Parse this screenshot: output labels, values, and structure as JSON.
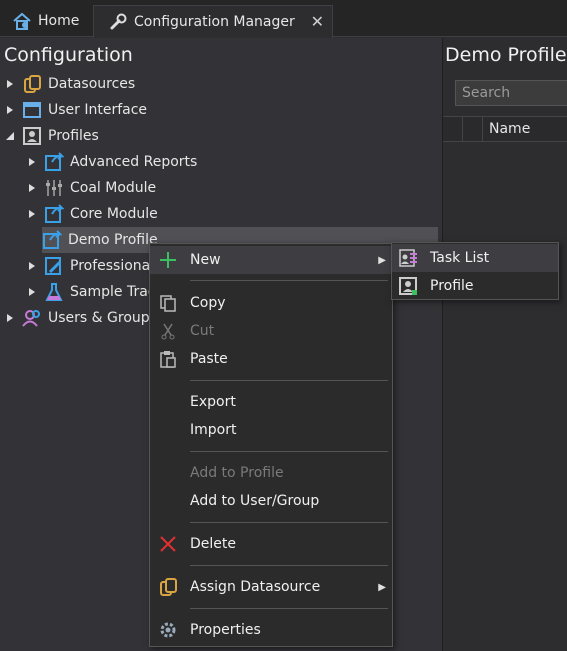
{
  "tabs": [
    {
      "label": "Home",
      "icon": "home-icon"
    },
    {
      "label": "Configuration Manager",
      "icon": "wrench-icon",
      "close": "✕"
    }
  ],
  "left_panel": {
    "title": "Configuration",
    "tree": [
      {
        "label": "Datasources",
        "icon": "datasource-icon",
        "expanded": false
      },
      {
        "label": "User Interface",
        "icon": "window-icon",
        "expanded": false
      },
      {
        "label": "Profiles",
        "icon": "profile-icon",
        "expanded": true
      },
      {
        "label": "Advanced Reports",
        "icon": "profile-share-icon",
        "expanded": false
      },
      {
        "label": "Coal Module",
        "icon": "coal-icon",
        "expanded": false
      },
      {
        "label": "Core Module",
        "icon": "profile-share-icon",
        "expanded": false
      },
      {
        "label": "Demo Profile",
        "icon": "profile-share-icon",
        "selected": true
      },
      {
        "label": "Professional",
        "icon": "profile-edit-icon",
        "expanded": false
      },
      {
        "label": "Sample Trac",
        "icon": "flask-icon",
        "expanded": false
      },
      {
        "label": "Users & Groups",
        "icon": "users-icon",
        "expanded": false
      }
    ]
  },
  "right_panel": {
    "title": "Demo Profile",
    "search_placeholder": "Search",
    "column_name": "Name"
  },
  "context_menu": {
    "new": "New",
    "copy": "Copy",
    "cut": "Cut",
    "paste": "Paste",
    "export": "Export",
    "import": "Import",
    "add_to_profile": "Add to Profile",
    "add_to_user_group": "Add to User/Group",
    "delete": "Delete",
    "assign_datasource": "Assign Datasource",
    "properties": "Properties"
  },
  "submenu": {
    "task_list": "Task List",
    "profile": "Profile"
  },
  "colors": {
    "accent_blue": "#3aa0e8",
    "delete_red": "#e03030",
    "new_green": "#3cc060",
    "folder_gold": "#d9a441"
  }
}
